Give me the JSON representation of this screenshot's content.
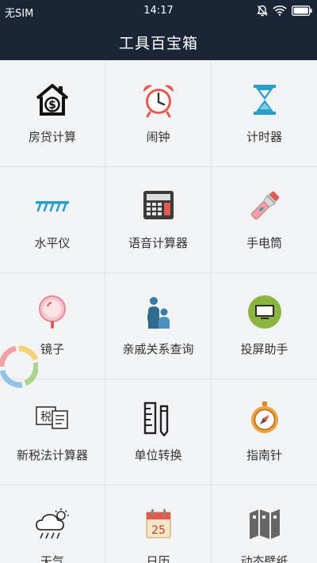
{
  "status_bar": {
    "carrier": "无SIM",
    "time": "14:17",
    "icons": [
      "mute-bell-icon",
      "wifi-icon",
      "battery-icon"
    ]
  },
  "title_bar": {
    "title": "工具百宝箱"
  },
  "tools": [
    {
      "label": "房贷计算",
      "icon": "house-dollar-icon"
    },
    {
      "label": "闹钟",
      "icon": "alarm-clock-icon"
    },
    {
      "label": "计时器",
      "icon": "hourglass-icon"
    },
    {
      "label": "水平仪",
      "icon": "level-ruler-icon"
    },
    {
      "label": "语音计算器",
      "icon": "calculator-icon"
    },
    {
      "label": "手电筒",
      "icon": "flashlight-icon"
    },
    {
      "label": "镜子",
      "icon": "hand-mirror-icon"
    },
    {
      "label": "亲戚关系查询",
      "icon": "relatives-icon"
    },
    {
      "label": "投屏助手",
      "icon": "screen-cast-icon"
    },
    {
      "label": "新税法计算器",
      "icon": "tax-form-icon"
    },
    {
      "label": "单位转换",
      "icon": "unit-convert-icon"
    },
    {
      "label": "指南针",
      "icon": "compass-icon"
    },
    {
      "label": "天气",
      "icon": "weather-cloud-icon"
    },
    {
      "label": "日历",
      "icon": "calendar-icon",
      "day": "25"
    },
    {
      "label": "动态壁纸",
      "icon": "wallpaper-map-icon"
    }
  ],
  "colors": {
    "bar": "#1a2636",
    "background": "#f2f3f5",
    "teal": "#2a9fc7",
    "coral": "#e35a50"
  }
}
